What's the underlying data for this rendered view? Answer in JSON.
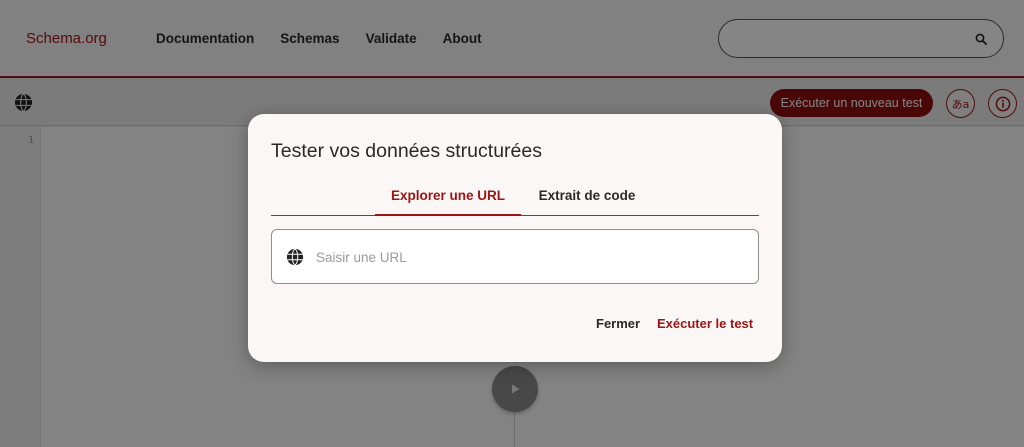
{
  "header": {
    "logo": "Schema.org",
    "nav": [
      "Documentation",
      "Schemas",
      "Validate",
      "About"
    ],
    "search": {
      "placeholder": "",
      "icon": "search-icon"
    }
  },
  "toolbar": {
    "globe_icon": "globe-icon",
    "run_new_test_label": "Exécuter un nouveau test",
    "language_label": "あa",
    "info_label": "i"
  },
  "editor": {
    "line_numbers": [
      "1"
    ]
  },
  "dialog": {
    "title": "Tester vos données structurées",
    "tabs": [
      {
        "label": "Explorer une URL",
        "active": true
      },
      {
        "label": "Extrait de code",
        "active": false
      }
    ],
    "url_input": {
      "placeholder": "Saisir une URL",
      "value": ""
    },
    "close_label": "Fermer",
    "run_label": "Exécuter le test"
  },
  "colors": {
    "accent": "#9c1414",
    "button_bg": "#8e0e0e",
    "overlay": "rgba(0,0,0,0.48)"
  }
}
